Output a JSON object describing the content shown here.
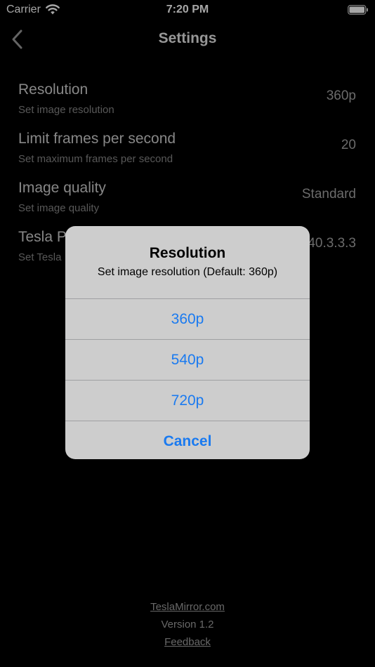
{
  "status_bar": {
    "carrier": "Carrier",
    "time": "7:20 PM"
  },
  "nav": {
    "title": "Settings"
  },
  "settings": [
    {
      "title": "Resolution",
      "subtitle": "Set image resolution",
      "value": "360p"
    },
    {
      "title": "Limit frames per second",
      "subtitle": "Set maximum frames per second",
      "value": "20"
    },
    {
      "title": "Image quality",
      "subtitle": "Set image quality",
      "value": "Standard"
    },
    {
      "title": "Tesla P",
      "subtitle": "Set Tesla",
      "value": "40.3.3.3"
    }
  ],
  "alert": {
    "title": "Resolution",
    "message": "Set image resolution (Default: 360p)",
    "options": [
      "360p",
      "540p",
      "720p"
    ],
    "cancel": "Cancel"
  },
  "footer": {
    "link": "TeslaMirror.com",
    "version": "Version 1.2",
    "feedback": "Feedback"
  },
  "colors": {
    "accent": "#1a7af0",
    "background": "#000000",
    "alert_bg": "#cdcdcd"
  }
}
